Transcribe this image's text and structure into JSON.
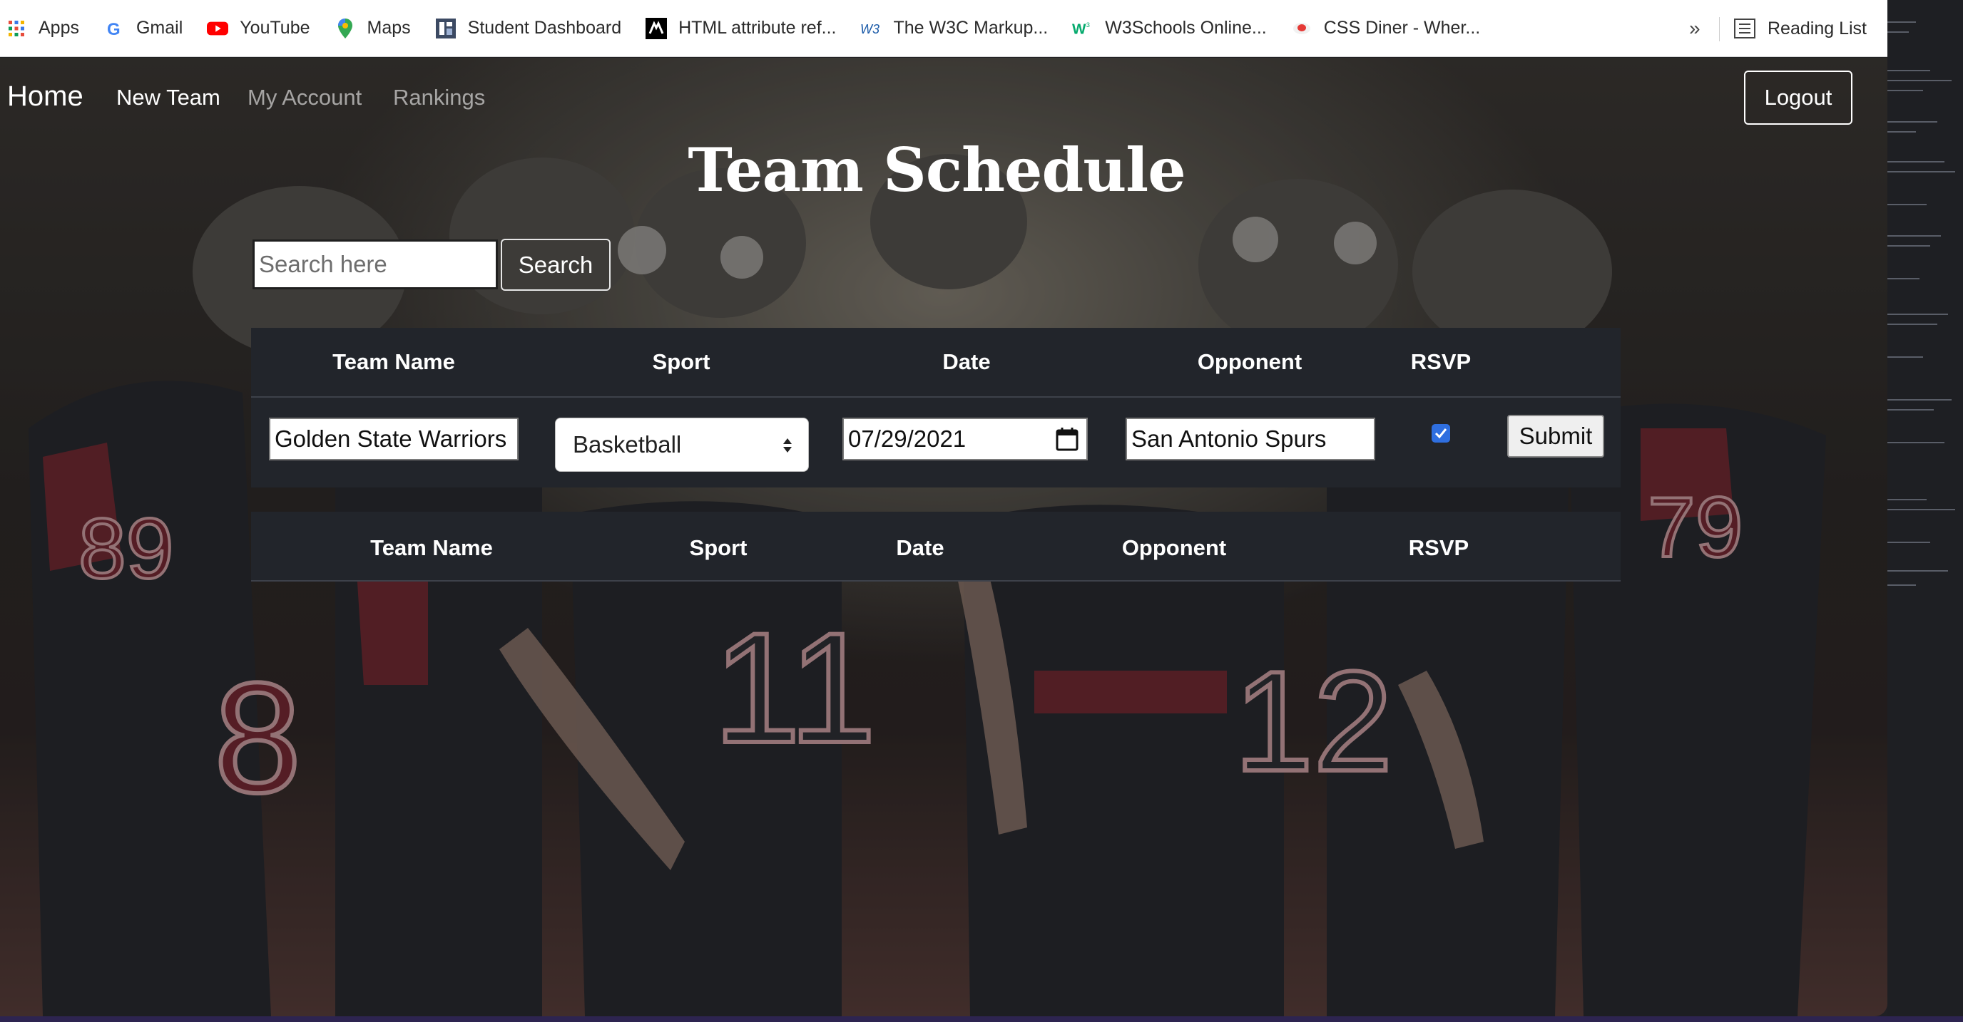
{
  "bookmarks": {
    "items": [
      {
        "label": "Apps",
        "icon": "apps-grid-icon"
      },
      {
        "label": "Gmail",
        "icon": "google-icon"
      },
      {
        "label": "YouTube",
        "icon": "youtube-icon"
      },
      {
        "label": "Maps",
        "icon": "maps-pin-icon"
      },
      {
        "label": "Student Dashboard",
        "icon": "dashboard-icon"
      },
      {
        "label": "HTML attribute ref...",
        "icon": "mdn-icon"
      },
      {
        "label": "The W3C Markup...",
        "icon": "w3c-icon"
      },
      {
        "label": "W3Schools Online...",
        "icon": "w3schools-icon"
      },
      {
        "label": "CSS Diner - Wher...",
        "icon": "css-diner-icon"
      }
    ],
    "overflow": "»",
    "reading_list": "Reading List"
  },
  "nav": {
    "home": "Home",
    "links": [
      "New Team",
      "My Account",
      "Rankings"
    ],
    "logout": "Logout"
  },
  "title": "Team Schedule",
  "search": {
    "placeholder": "Search here",
    "button": "Search"
  },
  "form_table": {
    "headers": [
      "Team Name",
      "Sport",
      "Date",
      "Opponent",
      "RSVP"
    ],
    "row": {
      "team_name": "Golden State Warriors",
      "sport": "Basketball",
      "date": "07/29/2021",
      "opponent": "San Antonio Spurs",
      "rsvp_checked": true,
      "submit": "Submit"
    }
  },
  "schedule_table": {
    "headers": [
      "Team Name",
      "Sport",
      "Date",
      "Opponent",
      "RSVP"
    ]
  },
  "colors": {
    "table_bg": "#22252b",
    "checkbox": "#2f6fe0"
  }
}
